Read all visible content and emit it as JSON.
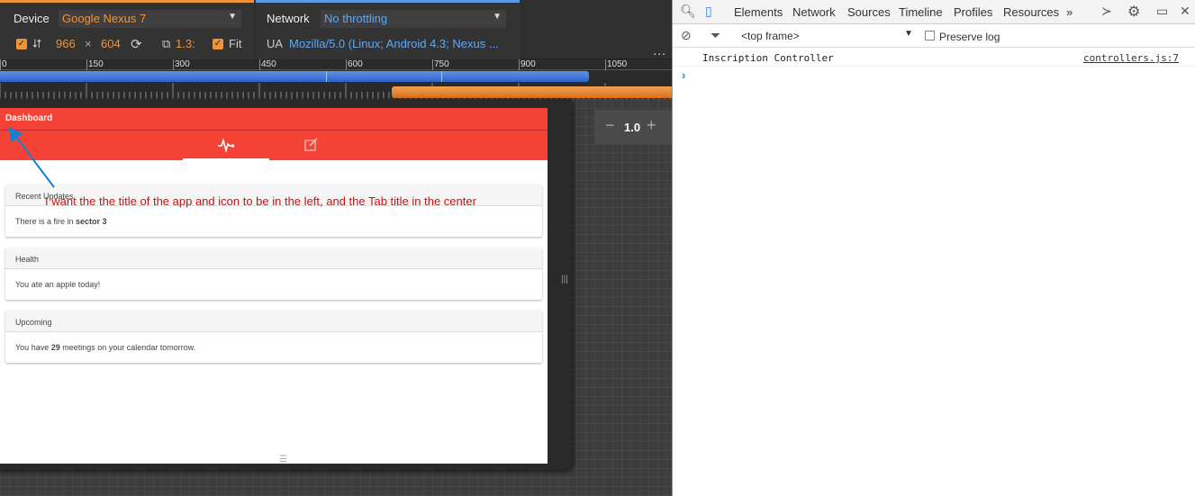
{
  "device_toolbar": {
    "device_label": "Device",
    "device_value": "Google Nexus 7",
    "width": "966",
    "times": "×",
    "height": "604",
    "scale": "1.3:",
    "fit_label": "Fit",
    "network_label": "Network",
    "network_value": "No throttling",
    "ua_label": "UA",
    "ua_value": "Mozilla/5.0 (Linux; Android 4.3; Nexus ...",
    "more": "..."
  },
  "ruler": {
    "labels": [
      "0",
      "150",
      "300",
      "450",
      "600",
      "750",
      "900",
      "1050"
    ]
  },
  "zoom": {
    "minus": "−",
    "value": "1.0",
    "plus": "+"
  },
  "app": {
    "title": "Dashboard",
    "cards": [
      {
        "header": "Recent Updates",
        "body_pre": "There is a fire in ",
        "body_bold": "sector 3",
        "body_post": ""
      },
      {
        "header": "Health",
        "body_pre": "You ate an apple today!",
        "body_bold": "",
        "body_post": ""
      },
      {
        "header": "Upcoming",
        "body_pre": "You have ",
        "body_bold": "29",
        "body_post": " meetings on your calendar tomorrow."
      }
    ]
  },
  "annotation": "I want the the title of the app and icon to be in the left, and the Tab title in the center",
  "devtools": {
    "tabs": [
      "Elements",
      "Network",
      "Sources",
      "Timeline",
      "Profiles",
      "Resources"
    ],
    "more_tabs": "»",
    "frame": "<top frame>",
    "preserve_log": "Preserve log",
    "log_message": "Inscription Controller",
    "log_source": "controllers.js:7",
    "prompt": "›"
  },
  "colors": {
    "app_red": "#f44336",
    "device_accent": "#f0943b",
    "network_accent": "#5b9ae3",
    "annotation": "#d01010"
  }
}
